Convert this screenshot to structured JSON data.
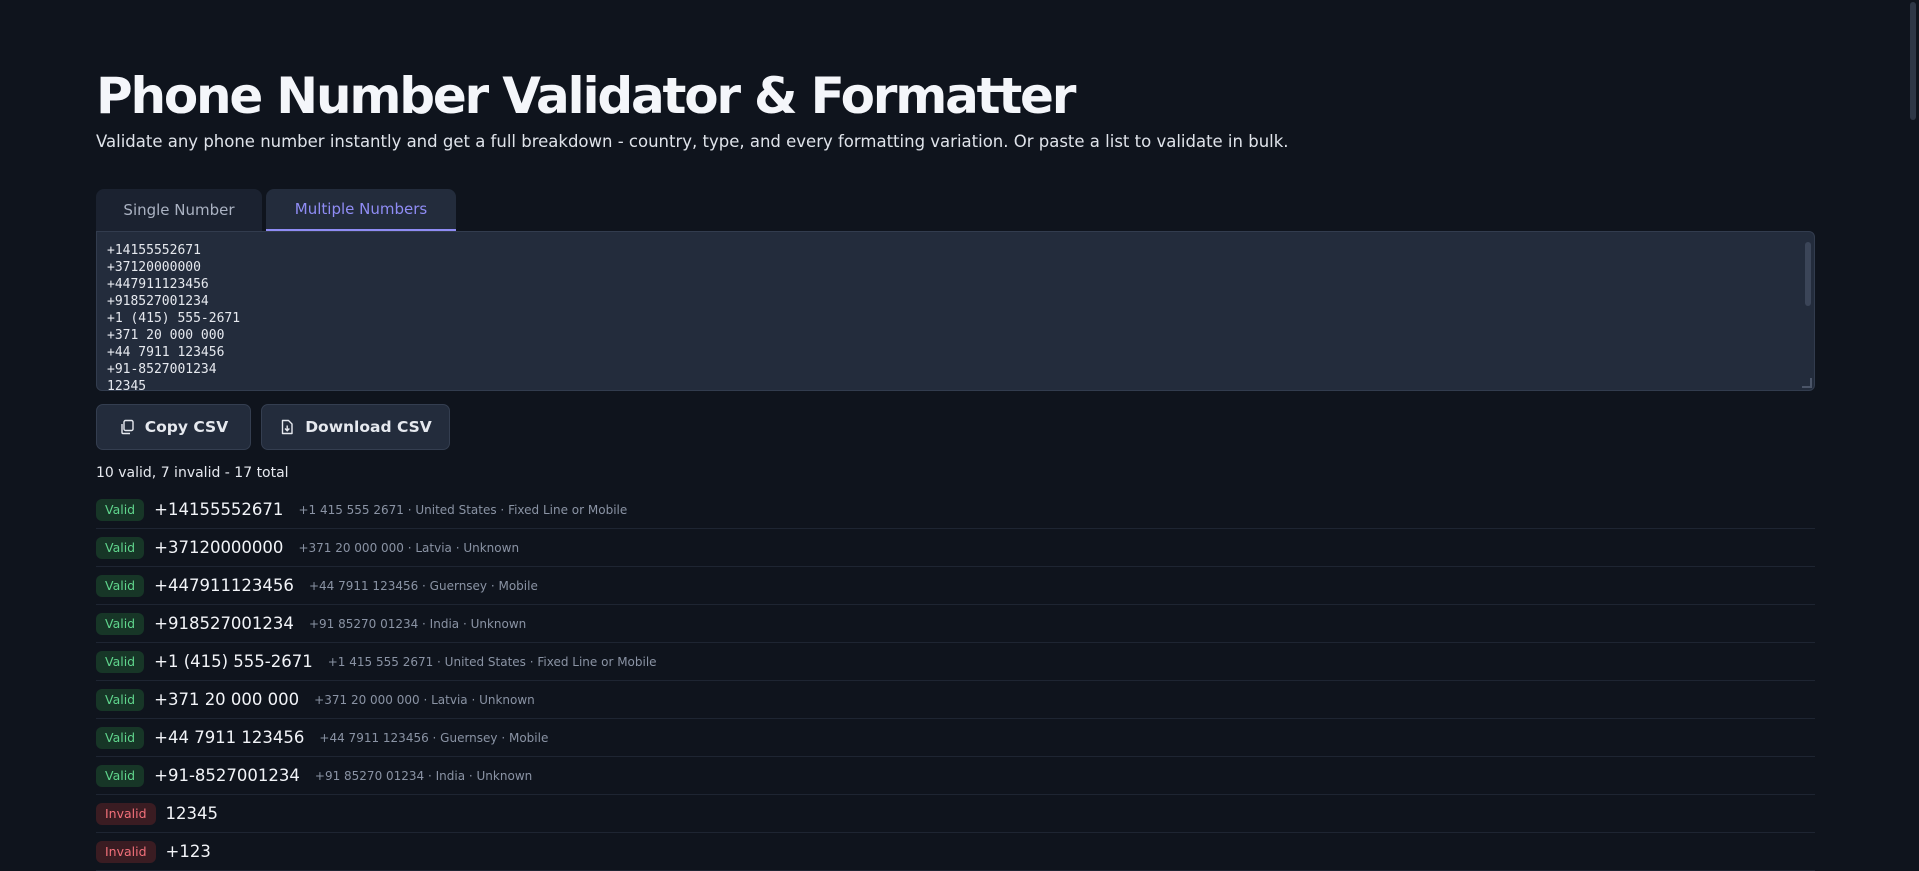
{
  "header": {
    "title": "Phone Number Validator & Formatter",
    "subtitle": "Validate any phone number instantly and get a full breakdown - country, type, and every formatting variation. Or paste a list to validate in bulk."
  },
  "tabs": [
    {
      "label": "Single Number",
      "active": false
    },
    {
      "label": "Multiple Numbers",
      "active": true
    }
  ],
  "input": {
    "value": "+14155552671\n+37120000000\n+447911123456\n+918527001234\n+1 (415) 555-2671\n+371 20 000 000\n+44 7911 123456\n+91-8527001234\n12345"
  },
  "actions": {
    "copy_label": "Copy CSV",
    "download_label": "Download CSV"
  },
  "summary": "10 valid, 7 invalid - 17 total",
  "results": [
    {
      "status": "Valid",
      "number": "+14155552671",
      "details": "+1 415 555 2671 · United States · Fixed Line or Mobile"
    },
    {
      "status": "Valid",
      "number": "+37120000000",
      "details": "+371 20 000 000 · Latvia · Unknown"
    },
    {
      "status": "Valid",
      "number": "+447911123456",
      "details": "+44 7911 123456 · Guernsey · Mobile"
    },
    {
      "status": "Valid",
      "number": "+918527001234",
      "details": "+91 85270 01234 · India · Unknown"
    },
    {
      "status": "Valid",
      "number": "+1 (415) 555-2671",
      "details": "+1 415 555 2671 · United States · Fixed Line or Mobile"
    },
    {
      "status": "Valid",
      "number": "+371 20 000 000",
      "details": "+371 20 000 000 · Latvia · Unknown"
    },
    {
      "status": "Valid",
      "number": "+44 7911 123456",
      "details": "+44 7911 123456 · Guernsey · Mobile"
    },
    {
      "status": "Valid",
      "number": "+91-8527001234",
      "details": "+91 85270 01234 · India · Unknown"
    },
    {
      "status": "Invalid",
      "number": "12345",
      "details": ""
    },
    {
      "status": "Invalid",
      "number": "+123",
      "details": ""
    }
  ],
  "colors": {
    "background": "#0f141d",
    "accent": "#8f8cf4",
    "valid": "#5fd48c",
    "invalid": "#f2707a"
  },
  "icons": {
    "copy": "copy-icon",
    "download": "file-download-icon"
  }
}
